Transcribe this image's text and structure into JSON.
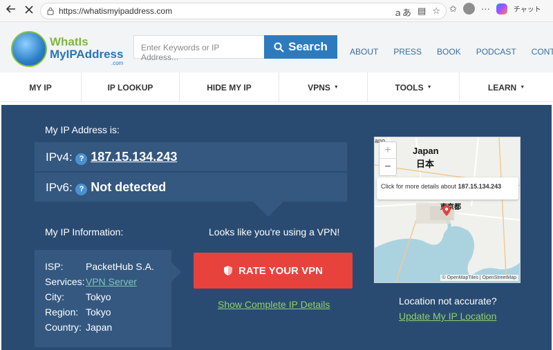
{
  "browser": {
    "url": "https://whatismyipaddress.com",
    "chat_label": "チャット"
  },
  "header": {
    "logo_line1": "WhatIs",
    "logo_line2": "MyIPAddress",
    "logo_dotcom": ".com",
    "search_placeholder": "Enter Keywords or IP Address...",
    "search_label": "Search",
    "links": [
      "ABOUT",
      "PRESS",
      "BOOK",
      "PODCAST",
      "CONTACT"
    ]
  },
  "menu": [
    {
      "label": "MY IP",
      "caret": false
    },
    {
      "label": "IP LOOKUP",
      "caret": false
    },
    {
      "label": "HIDE MY IP",
      "caret": false
    },
    {
      "label": "VPNS",
      "caret": true
    },
    {
      "label": "TOOLS",
      "caret": true
    },
    {
      "label": "LEARN",
      "caret": true
    }
  ],
  "ip": {
    "heading": "My IP Address is:",
    "ipv4_label": "IPv4:",
    "ipv4_value": "187.15.134.243",
    "ipv6_label": "IPv6:",
    "ipv6_value": "Not detected"
  },
  "info": {
    "heading": "My IP Information:",
    "rows": [
      {
        "key": "ISP:",
        "value": "PacketHub S.A."
      },
      {
        "key": "Services:",
        "value": "VPN Server"
      },
      {
        "key": "City:",
        "value": "Tokyo"
      },
      {
        "key": "Region:",
        "value": "Tokyo"
      },
      {
        "key": "Country:",
        "value": "Japan"
      }
    ]
  },
  "vpn": {
    "note": "Looks like you're using a VPN!",
    "rate_label": "RATE YOUR VPN",
    "show_details": "Show Complete IP Details"
  },
  "map": {
    "country_en": "Japan",
    "country_ja": "日本",
    "city_ja": "東京都",
    "popup_prefix": "Click for more details about",
    "popup_ip": "187.15.134.243",
    "attribution": "© OpenMapTiles | OpenStreetMap",
    "corner_text": "ano"
  },
  "location": {
    "question": "Location not accurate?",
    "update_label": "Update My IP Location"
  },
  "colors": {
    "panel": "#2a4b71",
    "rate_button": "#e8423d",
    "search_button": "#2d7bbf",
    "link_green": "#8dd16b"
  }
}
